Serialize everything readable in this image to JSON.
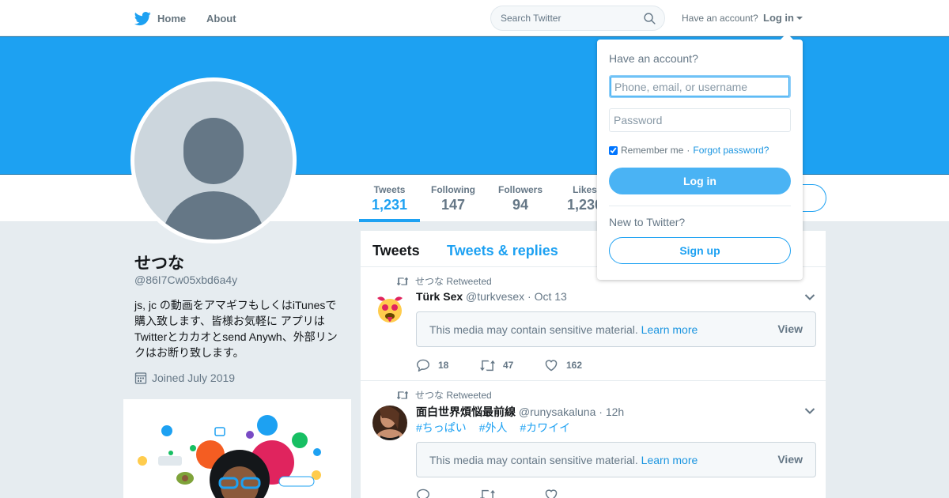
{
  "colors": {
    "accent": "#1da1f2",
    "banner": "#1da1f2",
    "background": "#e6ecf0"
  },
  "nav": {
    "home_label": "Home",
    "about_label": "About",
    "search_placeholder": "Search Twitter",
    "have_account": "Have an account?",
    "login_label": "Log in"
  },
  "profile": {
    "name": "せつな",
    "handle": "@86I7Cw05xbd6a4y",
    "bio": "js, jc の動画をアマギフもしくはiTunesで購入致します、皆様お気軽に アプリはTwitterとカカオとsend Anywh、外部リンクはお断り致します。",
    "joined": "Joined July 2019"
  },
  "stats": [
    {
      "label": "Tweets",
      "value": "1,231"
    },
    {
      "label": "Following",
      "value": "147"
    },
    {
      "label": "Followers",
      "value": "94"
    },
    {
      "label": "Likes",
      "value": "1,230"
    }
  ],
  "timeline": {
    "tab_tweets": "Tweets",
    "tab_replies": "Tweets & replies",
    "tweets": [
      {
        "retweet_context": "せつな Retweeted",
        "author_name": "Türk Sex",
        "author_handle": "@turkvesex",
        "time": "· Oct 13",
        "hashtags": [],
        "sensitive_text": "This media may contain sensitive material.",
        "learn_more": "Learn more",
        "view_label": "View",
        "replies": "18",
        "retweets": "47",
        "likes": "162"
      },
      {
        "retweet_context": "せつな Retweeted",
        "author_name": "面白世界煩悩最前線",
        "author_handle": "@runysakaluna",
        "time": "· 12h",
        "hashtags": [
          "#ちっぱい",
          "#外人",
          "#カワイイ"
        ],
        "sensitive_text": "This media may contain sensitive material.",
        "learn_more": "Learn more",
        "view_label": "View"
      }
    ]
  },
  "login_dropdown": {
    "title": "Have an account?",
    "username_placeholder": "Phone, email, or username",
    "password_placeholder": "Password",
    "remember_label": "Remember me",
    "separator": "·",
    "forgot_label": "Forgot password?",
    "login_button": "Log in",
    "new_to_twitter": "New to Twitter?",
    "signup_button": "Sign up"
  },
  "icons": [
    "twitter-bird-icon",
    "search-icon",
    "calendar-icon",
    "retweet-icon",
    "reply-icon",
    "like-icon",
    "chevron-down-icon"
  ]
}
